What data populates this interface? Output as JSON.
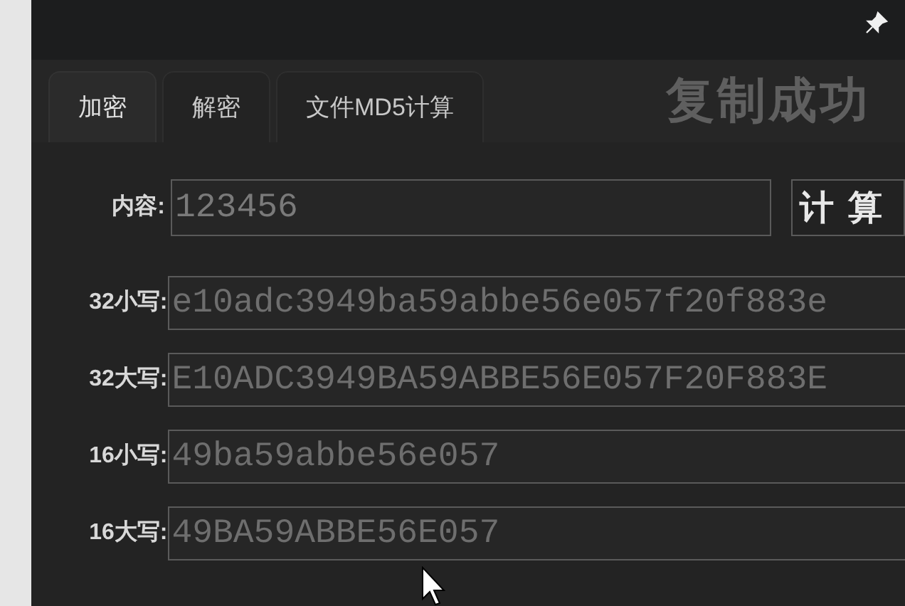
{
  "tabs": [
    {
      "label": "加密",
      "selected": true
    },
    {
      "label": "解密",
      "selected": false
    },
    {
      "label": "文件MD5计算",
      "selected": false
    }
  ],
  "status": "复制成功",
  "input": {
    "label": "内容:",
    "value": "123456"
  },
  "button": "计算",
  "results": [
    {
      "label": "32小写:",
      "value": "e10adc3949ba59abbe56e057f20f883e"
    },
    {
      "label": "32大写:",
      "value": "E10ADC3949BA59ABBE56E057F20F883E"
    },
    {
      "label": "16小写:",
      "value": "49ba59abbe56e057"
    },
    {
      "label": "16大写:",
      "value": "49BA59ABBE56E057"
    }
  ]
}
